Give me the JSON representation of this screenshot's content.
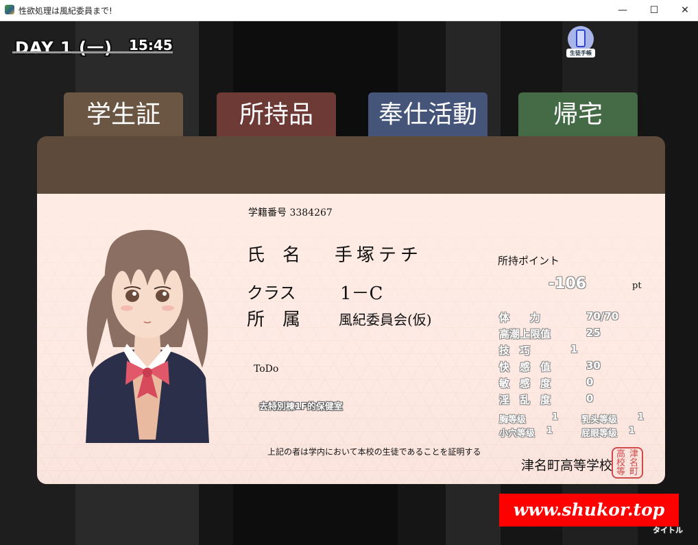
{
  "window": {
    "title": "性欲処理は風紀委員まで!",
    "minimize_glyph": "—",
    "maximize_glyph": "☐",
    "close_glyph": "✕"
  },
  "hud": {
    "day": "DAY 1 (一)",
    "time": "15:45",
    "handbook_label": "生徒手帳"
  },
  "tabs": [
    {
      "label": "学生証",
      "color": "#6b5644"
    },
    {
      "label": "所持品",
      "color": "#6e3a36"
    },
    {
      "label": "奉仕活動",
      "color": "#45557a"
    },
    {
      "label": "帰宅",
      "color": "#456b46"
    }
  ],
  "card": {
    "student_number_label": "学籍番号",
    "student_number": "3384267",
    "name_label": "氏　名",
    "name": "手塚テチ",
    "class_label": "クラス",
    "class_value": "1－C",
    "affiliation_label": "所　属",
    "affiliation": "風紀委員会(仮)",
    "todo_label": "ToDo",
    "todo_task": "去特別棟1F的保健室",
    "certification": "上記の者は学内において本校の生徒であることを証明する",
    "school": "津名町高等学校",
    "seal_chars": [
      "高",
      "津",
      "校",
      "名",
      "等",
      "町"
    ],
    "points_label": "所持ポイント",
    "points_value": "-106",
    "points_unit": "pt"
  },
  "stats": [
    {
      "label": "体　　力",
      "value": "70/70"
    },
    {
      "label": "高潮上限值",
      "value": "25"
    },
    {
      "label": "技　巧",
      "value": "1"
    },
    {
      "label": "快　感　值",
      "value": "30"
    },
    {
      "label": "敏　感　度",
      "value": "0"
    },
    {
      "label": "淫　乱　度",
      "value": "0"
    }
  ],
  "grades": [
    {
      "label": "胸等级",
      "value": "1"
    },
    {
      "label": "乳头等级",
      "value": "1"
    },
    {
      "label": "小穴等级",
      "value": "1"
    },
    {
      "label": "屁眼等级",
      "value": "1"
    }
  ],
  "watermark": "www.shukor.top",
  "title_link": "タイトル"
}
